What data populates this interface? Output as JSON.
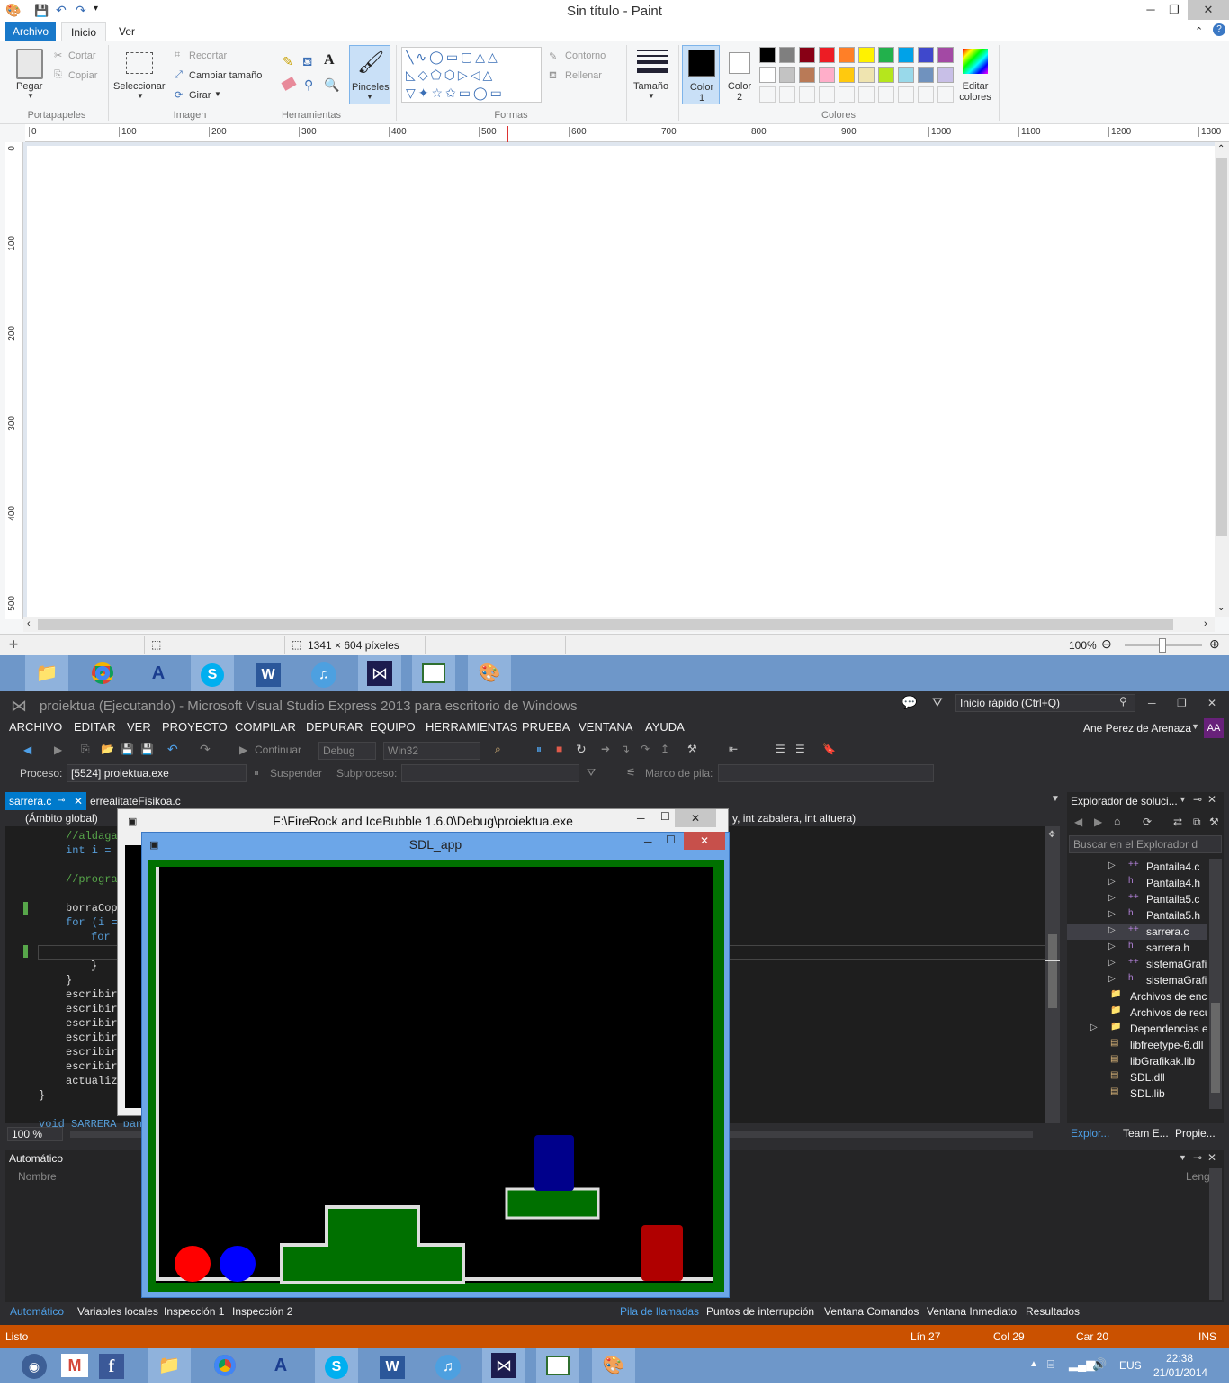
{
  "paint": {
    "title": "Sin título - Paint",
    "tabs": [
      "Archivo",
      "Inicio",
      "Ver"
    ],
    "clipboard": {
      "paste": "Pegar",
      "cut": "Cortar",
      "copy": "Copiar",
      "group": "Portapapeles"
    },
    "image": {
      "select": "Seleccionar",
      "crop": "Recortar",
      "resize": "Cambiar tamaño",
      "rotate": "Girar",
      "group": "Imagen"
    },
    "tools_group": "Herramientas",
    "brushes": "Pinceles",
    "shapes": {
      "outline": "Contorno",
      "fill": "Rellenar",
      "group": "Formas"
    },
    "size": "Tamaño",
    "color1": "Color 1",
    "color2": "Color 2",
    "edit_colors": "Editar colores",
    "colors_group": "Colores",
    "palette_row1": [
      "#000000",
      "#7f7f7f",
      "#880015",
      "#ed1c24",
      "#ff7f27",
      "#fff200",
      "#22b14c",
      "#00a2e8",
      "#3f48cc",
      "#a349a4"
    ],
    "palette_row2": [
      "#ffffff",
      "#c3c3c3",
      "#b97a57",
      "#ffaec9",
      "#ffc90e",
      "#efe4b0",
      "#b5e61d",
      "#99d9ea",
      "#7092be",
      "#c8bfe7"
    ],
    "ruler_h": [
      "0",
      "100",
      "200",
      "300",
      "400",
      "500",
      "600",
      "700",
      "800",
      "900",
      "1000",
      "1100",
      "1200",
      "1300"
    ],
    "ruler_v": [
      "0",
      "100",
      "200",
      "300",
      "400",
      "500"
    ],
    "canvas_size": "1341 × 604 píxeles",
    "zoom": "100%"
  },
  "vs": {
    "title": "proiektua (Ejecutando) - Microsoft Visual Studio Express 2013 para escritorio de Windows",
    "quick_launch": "Inicio rápido (Ctrl+Q)",
    "menu": [
      "ARCHIVO",
      "EDITAR",
      "VER",
      "PROYECTO",
      "COMPILAR",
      "DEPURAR",
      "EQUIPO",
      "HERRAMIENTAS",
      "PRUEBA",
      "VENTANA",
      "AYUDA"
    ],
    "user": "Ane Perez de Arenaza",
    "user_initials": "AA",
    "toolbar": {
      "continue": "Continuar",
      "config": "Debug",
      "platform": "Win32"
    },
    "process_label": "Proceso:",
    "process_value": "[5524] proiektua.exe",
    "suspend": "Suspender",
    "thread_label": "Subproceso:",
    "stack_frame_label": "Marco de pila:",
    "tabs": {
      "active": "sarrera.c",
      "other": "errealitateFisikoa.c"
    },
    "scope": "(Ámbito global)",
    "signature_fragment": "y, int zabalera, int altuera)",
    "code_lines": [
      "//aldaga",
      "int i = ",
      "//progra",
      "borraCop",
      "for (i =",
      "for",
      "}",
      "}",
      "escribir",
      "escribir",
      "escribir",
      "escribir",
      "escribir",
      "escribir",
      "actualiz",
      "}",
      "void SARRERA_pan"
    ],
    "zoom": "100 %",
    "solution_explorer": {
      "title": "Explorador de soluci...",
      "search": "Buscar en el Explorador d",
      "items": [
        "Pantaila4.c",
        "Pantaila4.h",
        "Pantaila5.c",
        "Pantaila5.h",
        "sarrera.c",
        "sarrera.h",
        "sistemaGrafik",
        "sistemaGrafik",
        "Archivos de enca",
        "Archivos de recu",
        "Dependencias ex",
        "libfreetype-6.dll",
        "libGrafikak.lib",
        "SDL.dll",
        "SDL.lib"
      ],
      "bottom_tabs": [
        "Explor...",
        "Team E...",
        "Propie..."
      ]
    },
    "autos": {
      "title": "Automático",
      "col_name": "Nombre",
      "col_lang": "Leng"
    },
    "bottom_tabs_left": [
      "Automático",
      "Variables locales",
      "Inspección 1",
      "Inspección 2"
    ],
    "bottom_tabs_right": [
      "Pila de llamadas",
      "Puntos de interrupción",
      "Ventana Comandos",
      "Ventana Inmediato",
      "Resultados"
    ],
    "status": {
      "ready": "Listo",
      "line": "Lín 27",
      "col": "Col 29",
      "char": "Car 20",
      "mode": "INS"
    }
  },
  "console": {
    "title": "F:\\FireRock and IceBubble 1.6.0\\Debug\\proiektua.exe"
  },
  "sdl": {
    "title": "SDL_app"
  },
  "taskbar": {
    "lang": "EUS",
    "time": "22:38",
    "date": "21/01/2014"
  }
}
